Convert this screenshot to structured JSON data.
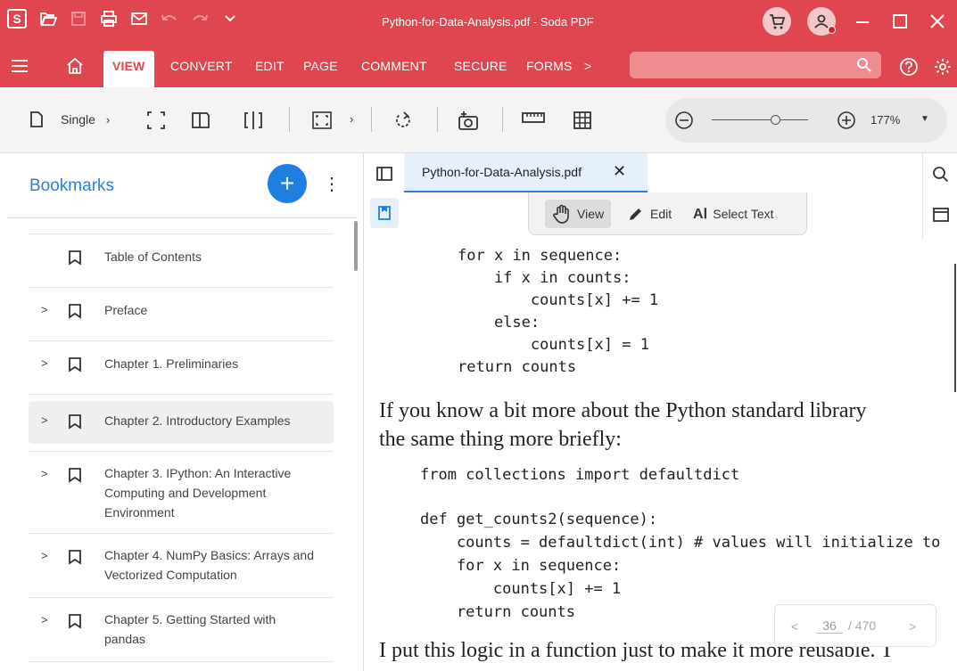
{
  "titlebar": {
    "logo": "S",
    "document_title": "Python-for-Data-Analysis.pdf  -  Soda PDF",
    "icons": [
      "open-folder-icon",
      "save-icon",
      "print-icon",
      "email-icon",
      "undo-icon",
      "redo-icon",
      "chevron-down-icon",
      "cart-icon",
      "account-icon",
      "minimize-icon",
      "maximize-icon",
      "close-icon"
    ]
  },
  "menubar": {
    "items": [
      "VIEW",
      "CONVERT",
      "EDIT",
      "PAGE",
      "COMMENT",
      "SECURE",
      "FORMS"
    ],
    "more": ">",
    "active": "VIEW"
  },
  "toolbar": {
    "single_label": "Single",
    "zoom": "177%"
  },
  "bookmarks": {
    "title": "Bookmarks",
    "add": "+",
    "items": [
      {
        "label": "Table of Contents",
        "chevron": ""
      },
      {
        "label": "Preface",
        "chevron": ">"
      },
      {
        "label": "Chapter 1. Preliminaries",
        "chevron": ">"
      },
      {
        "label": "Chapter 2. Introductory Examples",
        "chevron": ">",
        "selected": true
      },
      {
        "label": "Chapter 3. IPython: An Interactive Computing and Development Environment",
        "line1": "Chapter 3. IPython: An Interactive",
        "line2": "Computing and Development",
        "line3": "Environment",
        "chevron": ">"
      },
      {
        "label": "Chapter 4. NumPy Basics: Arrays and Vectorized Computation",
        "line1": "Chapter 4. NumPy Basics: Arrays and",
        "line2": "Vectorized Computation",
        "chevron": ">"
      },
      {
        "label": "Chapter 5. Getting Started with pandas",
        "line1": "Chapter 5. Getting Started with",
        "line2": "pandas",
        "chevron": ">"
      }
    ]
  },
  "document": {
    "tab_label": "Python-for-Data-Analysis.pdf",
    "modes": {
      "view": "View",
      "edit": "Edit",
      "select": "Select Text"
    },
    "code1": [
      "for x in sequence:",
      "    if x in counts:",
      "        counts[x] += 1",
      "    else:",
      "        counts[x] = 1",
      "return counts"
    ],
    "prose1": [
      "If you know a bit more about the Python standard library",
      "the same thing more briefly:"
    ],
    "code2": [
      "from collections import defaultdict",
      "",
      "def get_counts2(sequence):",
      "    counts = defaultdict(int) # values will initialize to",
      "    for x in sequence:",
      "        counts[x] += 1",
      "    return counts"
    ],
    "prose2": "I put this logic in a function just to make it more reusable. T"
  },
  "pager": {
    "current": "36",
    "total": "/ 470",
    "prev": "<",
    "next": ">"
  },
  "colors": {
    "brand": "#e0464f",
    "accent": "#1f7fe0",
    "bookmark_title": "#2f7fd6"
  }
}
